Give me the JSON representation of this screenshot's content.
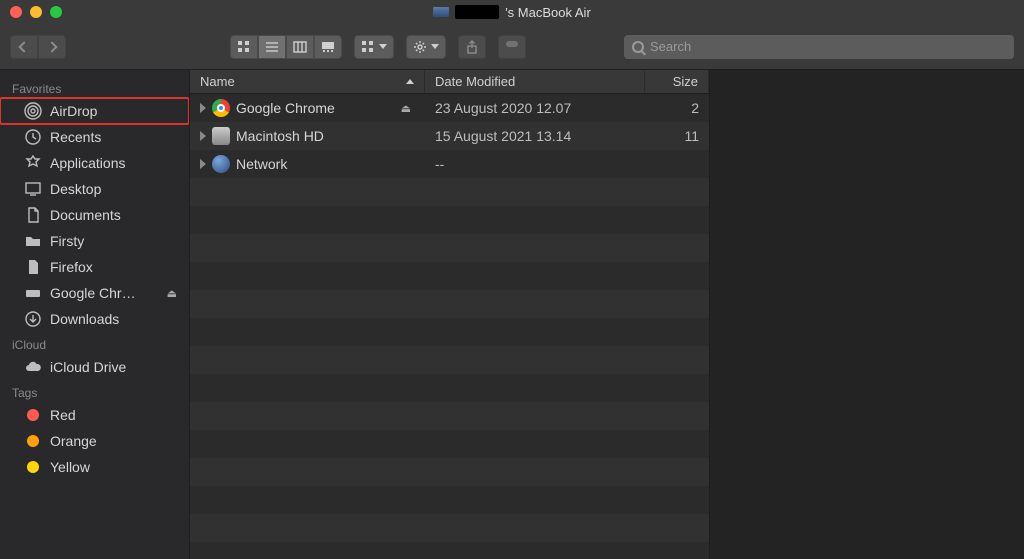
{
  "titlebar": {
    "title": "'s MacBook Air"
  },
  "toolbar": {
    "search_placeholder": "Search"
  },
  "sidebar": {
    "sections": [
      {
        "label": "Favorites",
        "items": [
          {
            "label": "AirDrop",
            "icon": "airdrop-icon",
            "highlighted": true
          },
          {
            "label": "Recents",
            "icon": "clock-icon"
          },
          {
            "label": "Applications",
            "icon": "applications-icon"
          },
          {
            "label": "Desktop",
            "icon": "desktop-icon"
          },
          {
            "label": "Documents",
            "icon": "document-icon"
          },
          {
            "label": "Firsty",
            "icon": "folder-icon"
          },
          {
            "label": "Firefox",
            "icon": "document-icon"
          },
          {
            "label": "Google Chr…",
            "icon": "drive-icon",
            "ejectable": true
          },
          {
            "label": "Downloads",
            "icon": "downloads-icon"
          }
        ]
      },
      {
        "label": "iCloud",
        "items": [
          {
            "label": "iCloud Drive",
            "icon": "cloud-icon"
          }
        ]
      },
      {
        "label": "Tags",
        "items": [
          {
            "label": "Red",
            "color": "#ff5b51",
            "dot_style": "background:#ff5b51"
          },
          {
            "label": "Orange",
            "color": "#ff9f0a",
            "dot_style": "background:#ff9f0a"
          },
          {
            "label": "Yellow",
            "color": "#ffd60a",
            "dot_style": "background:#ffd60a"
          }
        ]
      }
    ]
  },
  "list": {
    "columns": [
      "Name",
      "Date Modified",
      "Size"
    ],
    "sort_column": "Name",
    "sort_direction": "asc",
    "rows": [
      {
        "name": "Google Chrome",
        "icon": "chrome-app-icon",
        "ejectable": true,
        "date": "23 August 2020 12.07",
        "size": "2"
      },
      {
        "name": "Macintosh HD",
        "icon": "hd-icon",
        "date": "15 August 2021 13.14",
        "size": "11"
      },
      {
        "name": "Network",
        "icon": "network-icon",
        "date": "--",
        "size": ""
      }
    ]
  }
}
